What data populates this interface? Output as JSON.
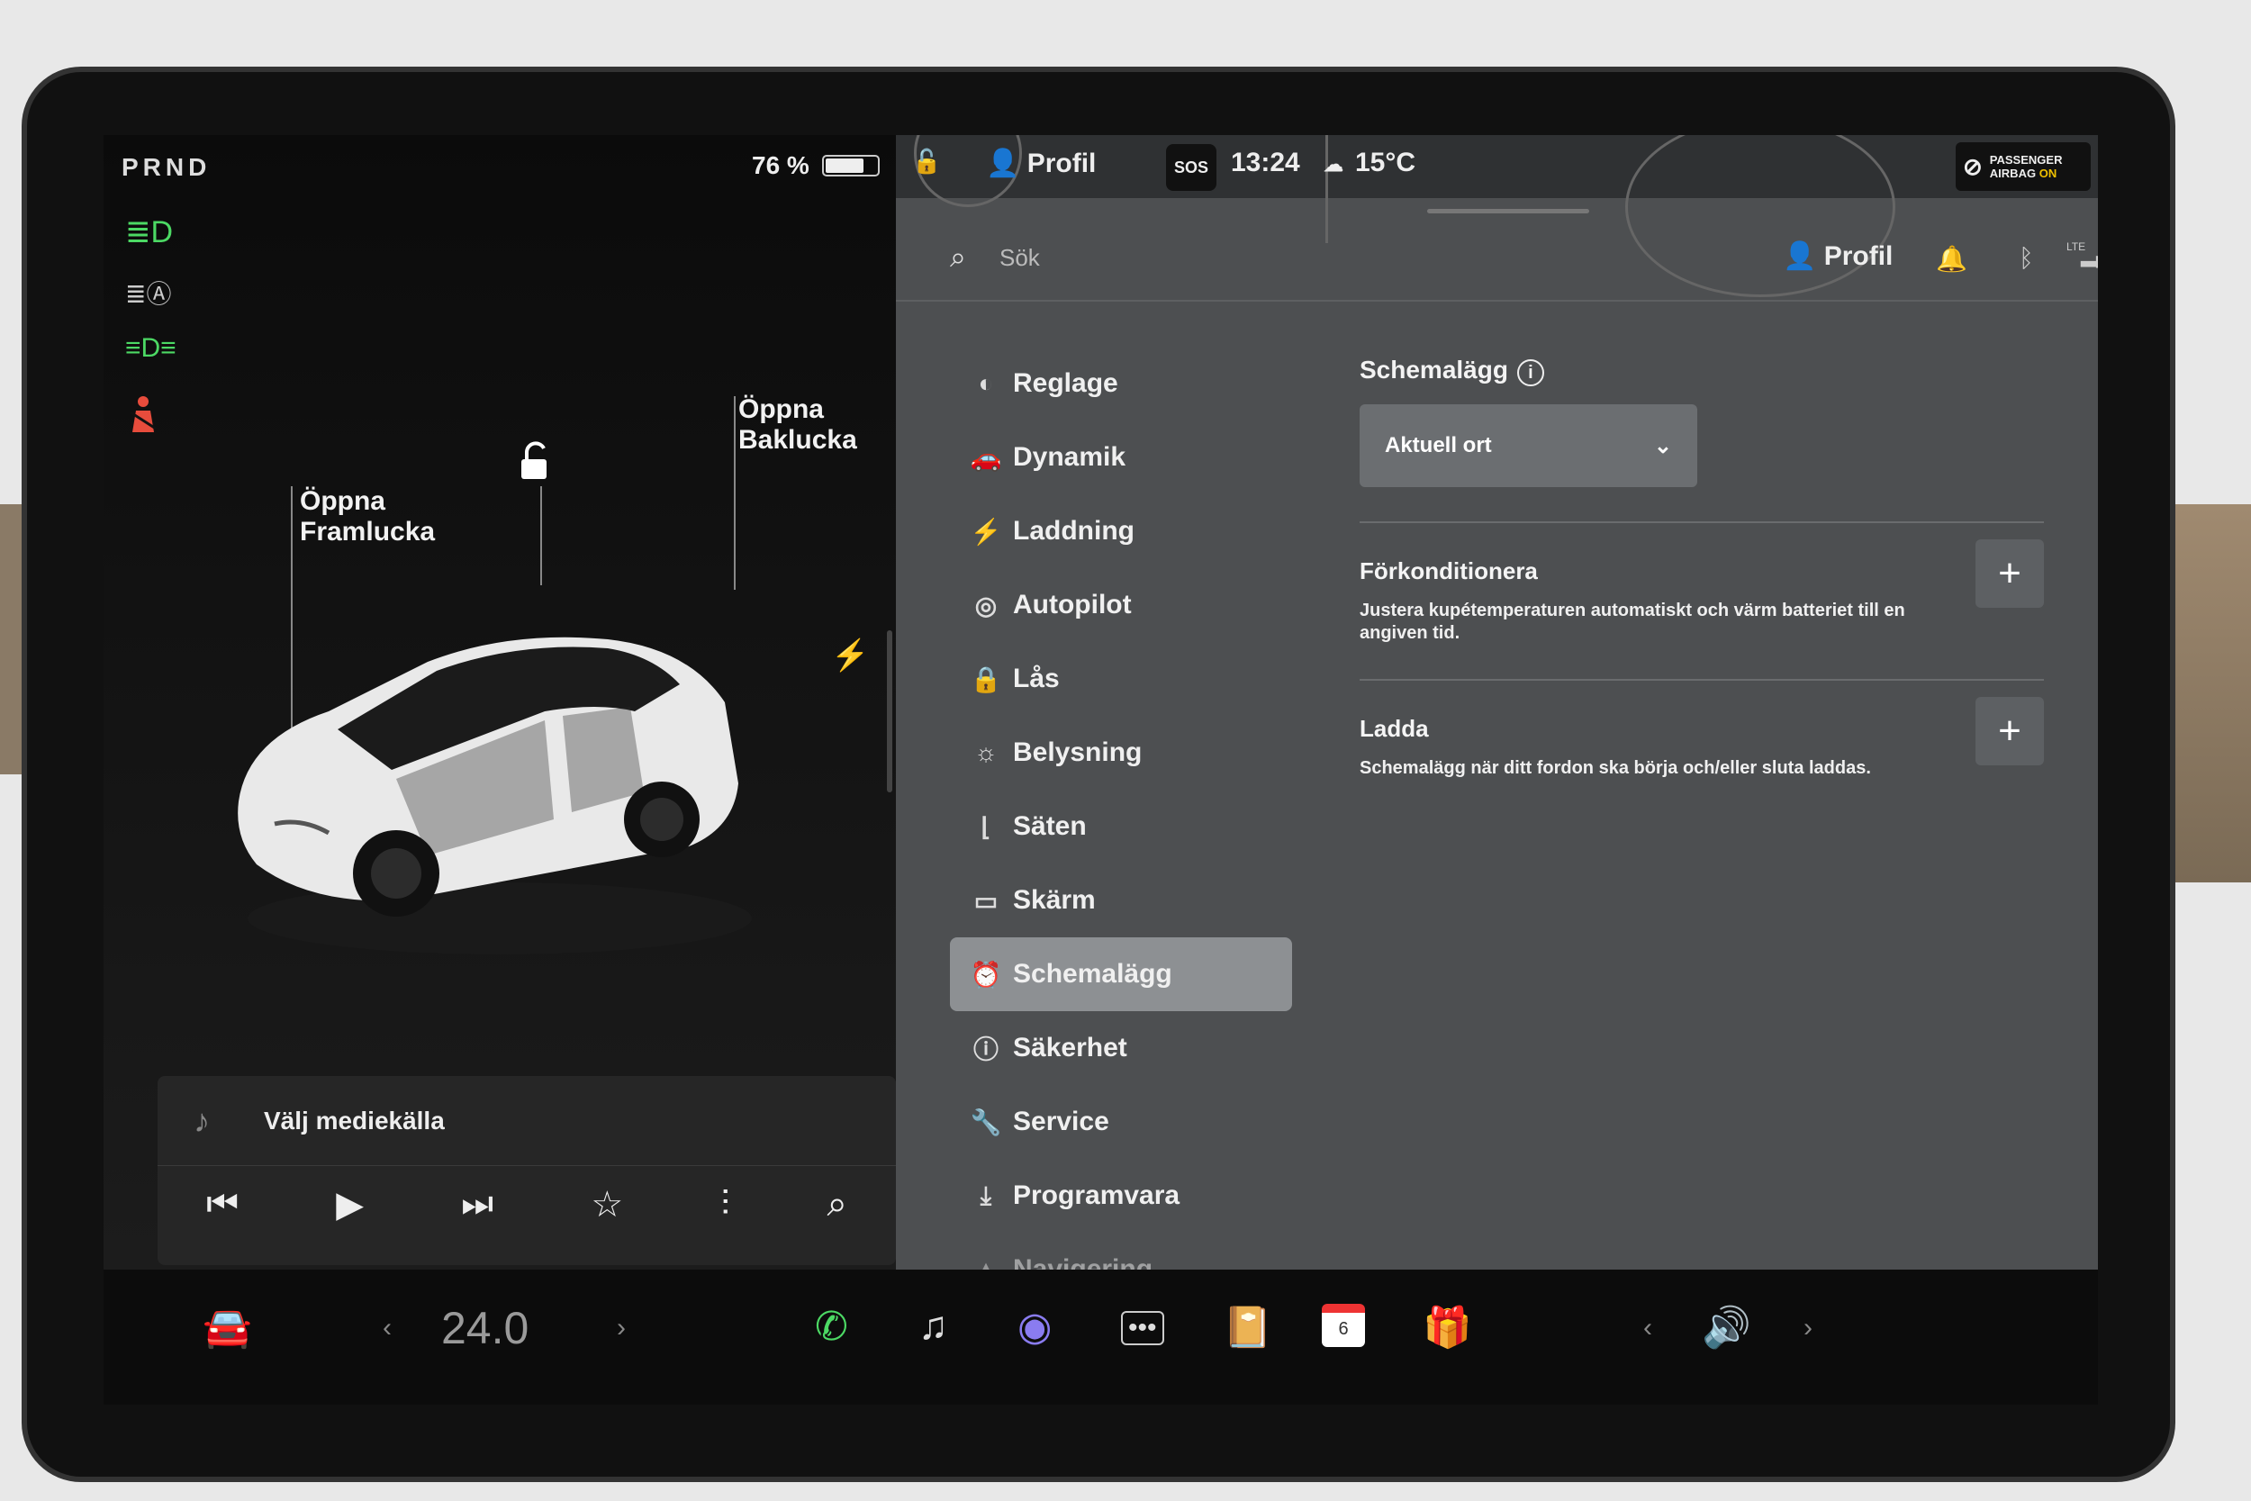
{
  "status": {
    "gear": "PRND",
    "battery_percent": "76 %",
    "battery_level": 0.76
  },
  "car_view": {
    "frunk_label": "Öppna\nFramlucka",
    "trunk_label": "Öppna\nBaklucka"
  },
  "media": {
    "source_label": "Välj mediekälla"
  },
  "topbar": {
    "profile": "Profil",
    "sos": "SOS",
    "time": "13:24",
    "temperature": "15°C",
    "airbag_line1": "PASSENGER",
    "airbag_line2": "AIRBAG",
    "airbag_state": "ON"
  },
  "header": {
    "search_placeholder": "Sök",
    "profile": "Profil",
    "network": "LTE"
  },
  "menu": [
    {
      "label": "Reglage",
      "icon": "toggle-icon"
    },
    {
      "label": "Dynamik",
      "icon": "car-icon"
    },
    {
      "label": "Laddning",
      "icon": "bolt-icon"
    },
    {
      "label": "Autopilot",
      "icon": "steering-wheel-icon"
    },
    {
      "label": "Lås",
      "icon": "lock-icon"
    },
    {
      "label": "Belysning",
      "icon": "sun-icon"
    },
    {
      "label": "Säten",
      "icon": "seat-icon"
    },
    {
      "label": "Skärm",
      "icon": "display-icon"
    },
    {
      "label": "Schemalägg",
      "icon": "alarm-clock-icon",
      "active": true
    },
    {
      "label": "Säkerhet",
      "icon": "alert-circle-icon"
    },
    {
      "label": "Service",
      "icon": "wrench-icon"
    },
    {
      "label": "Programvara",
      "icon": "download-icon"
    },
    {
      "label": "Navigering",
      "icon": "navigation-icon"
    }
  ],
  "schedule": {
    "title": "Schemalägg",
    "location_select": "Aktuell ort",
    "options": [
      {
        "title": "Förkonditionera",
        "desc": "Justera kupétemperaturen automatiskt och värm batteriet till en angiven tid."
      },
      {
        "title": "Ladda",
        "desc": "Schemalägg när ditt fordon ska börja och/eller sluta laddas."
      }
    ]
  },
  "bottom": {
    "temperature": "24.0",
    "calendar_day": "6"
  }
}
